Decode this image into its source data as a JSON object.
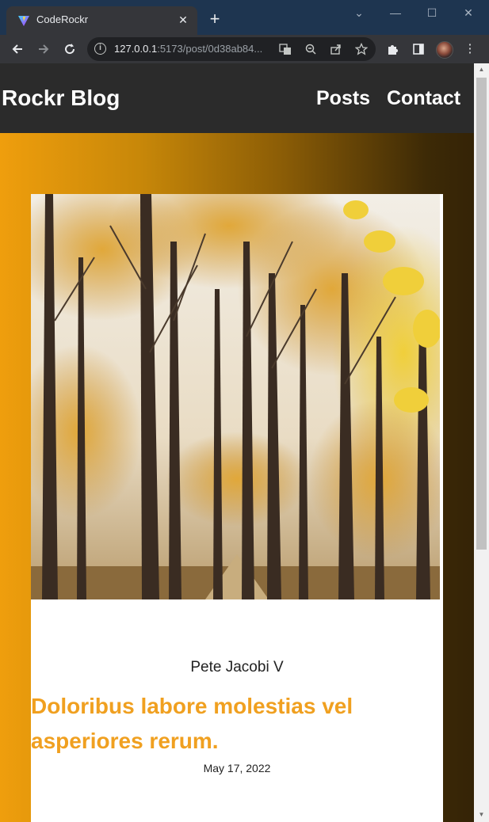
{
  "browser": {
    "tab_title": "CodeRockr",
    "tab_close": "✕",
    "new_tab": "+",
    "url_host": "127.0.0.1",
    "url_rest": ":5173/post/0d38ab84...",
    "window_controls": {
      "minimize": "—",
      "maximize": "☐",
      "close": "✕",
      "dropdown": "⌄"
    }
  },
  "icons": {
    "back": "arrow-left-icon",
    "forward": "arrow-right-icon",
    "reload": "reload-icon",
    "info": "info-icon",
    "translate": "translate-icon",
    "zoom": "zoom-out-icon",
    "share": "share-icon",
    "bookmark": "star-icon",
    "extensions": "puzzle-icon",
    "sidepanel": "side-panel-icon",
    "menu": "kebab-menu-icon"
  },
  "site": {
    "brand": "Rockr Blog",
    "nav": [
      {
        "label": "Posts"
      },
      {
        "label": "Contact"
      }
    ]
  },
  "post": {
    "date": "May 17, 2022",
    "author": "Pete Jacobi V",
    "title": "Doloribus labore molestias vel asperiores rerum.",
    "image_alt": "autumn-forest-photo"
  },
  "colors": {
    "accent": "#f0a020",
    "header_bg": "#2b2b2b",
    "gradient_start": "#ef9e0d",
    "gradient_end": "#342306"
  }
}
